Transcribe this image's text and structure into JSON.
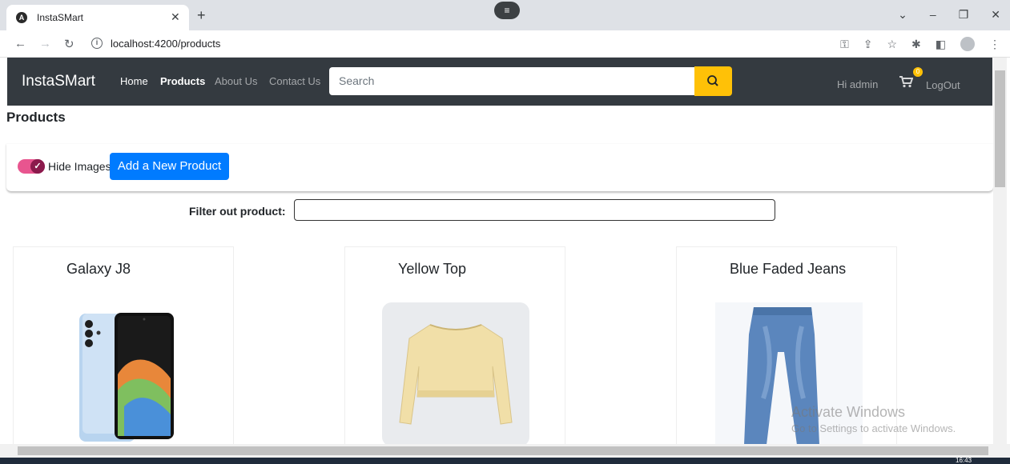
{
  "browser": {
    "tab_title": "InstaSMart",
    "url": "localhost:4200/products"
  },
  "navbar": {
    "brand": "InstaSMart",
    "links": [
      {
        "label": "Home"
      },
      {
        "label": "Products"
      },
      {
        "label": "About Us"
      },
      {
        "label": "Contact Us"
      }
    ],
    "search_placeholder": "Search",
    "greeting": "Hi admin",
    "cart_count": "0",
    "logout": "LogOut"
  },
  "page": {
    "title": "Products",
    "toggle_label": "Hide Images",
    "toggle_checked": true,
    "add_button": "Add a New Product",
    "filter_label": "Filter out product:",
    "filter_value": ""
  },
  "products": [
    {
      "name": "Galaxy J8"
    },
    {
      "name": "Yellow Top"
    },
    {
      "name": "Blue Faded Jeans"
    }
  ],
  "os": {
    "watermark_title": "Activate Windows",
    "watermark_sub": "Go to Settings to activate Windows.",
    "clock": "16:43"
  },
  "colors": {
    "navbar_bg": "#343a40",
    "search_button": "#ffc107",
    "primary_button": "#007bff",
    "toggle_on": "#e8558f"
  }
}
